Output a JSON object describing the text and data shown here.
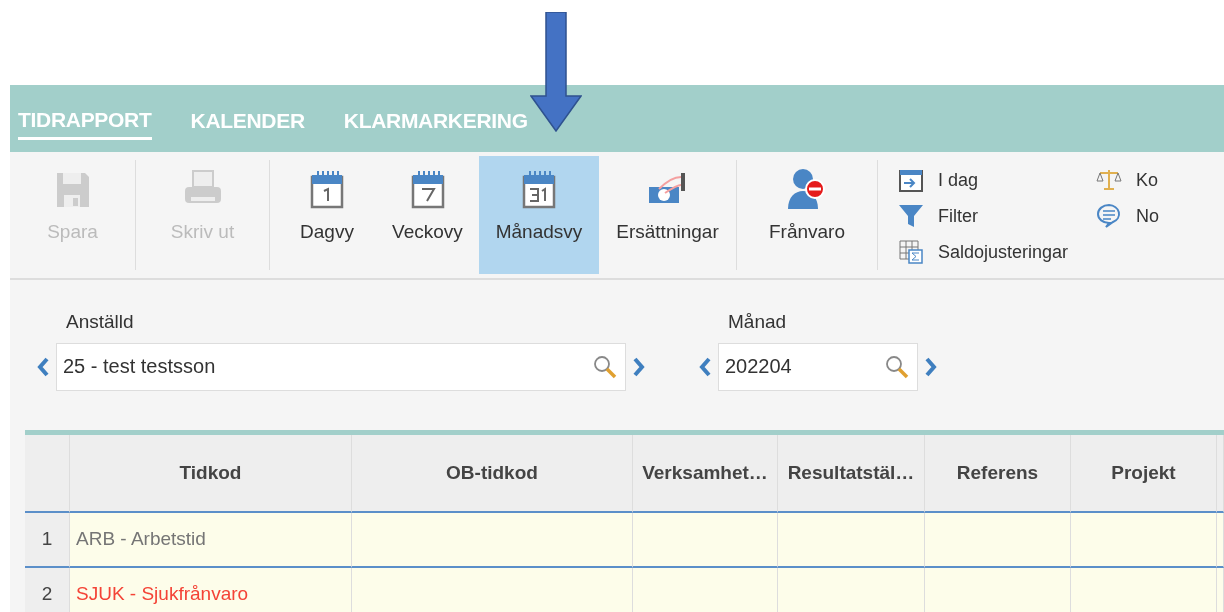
{
  "tabs": [
    {
      "label": "TIDRAPPORT",
      "selected": true
    },
    {
      "label": "KALENDER",
      "selected": false
    },
    {
      "label": "KLARMARKERING",
      "selected": false
    }
  ],
  "toolbar": [
    {
      "label": "Spara",
      "kind": "save",
      "disabled": true,
      "selected": false
    },
    {
      "label": "Skriv ut",
      "kind": "print",
      "disabled": true,
      "selected": false
    },
    {
      "label": "Dagvy",
      "kind": "cal1",
      "disabled": false,
      "selected": false
    },
    {
      "label": "Veckovy",
      "kind": "cal7",
      "disabled": false,
      "selected": false
    },
    {
      "label": "Månadsvy",
      "kind": "cal31",
      "disabled": false,
      "selected": true
    },
    {
      "label": "Ersättningar",
      "kind": "money",
      "disabled": false,
      "selected": false
    },
    {
      "label": "Frånvaro",
      "kind": "absence",
      "disabled": false,
      "selected": false
    }
  ],
  "small_tools": [
    [
      {
        "label": "I dag",
        "kind": "today"
      },
      {
        "label": "Filter",
        "kind": "filter"
      },
      {
        "label": "Saldojusteringar",
        "kind": "sum"
      }
    ],
    [
      {
        "label": "Ko",
        "kind": "scale"
      },
      {
        "label": "No",
        "kind": "note"
      }
    ]
  ],
  "employee": {
    "label": "Anställd",
    "value": "25 - test testsson"
  },
  "month": {
    "label": "Månad",
    "value": "202204"
  },
  "table": {
    "columns": [
      "Tidkod",
      "OB-tidkod",
      "Verksamhet…",
      "Resultatstäl…",
      "Referens",
      "Projekt"
    ],
    "rows": [
      {
        "number": "1",
        "tidkod": "ARB - Arbetstid",
        "color": "#757575"
      },
      {
        "number": "2",
        "tidkod": "SJUK - Sjukfrånvaro",
        "color": "#f44336"
      }
    ]
  }
}
